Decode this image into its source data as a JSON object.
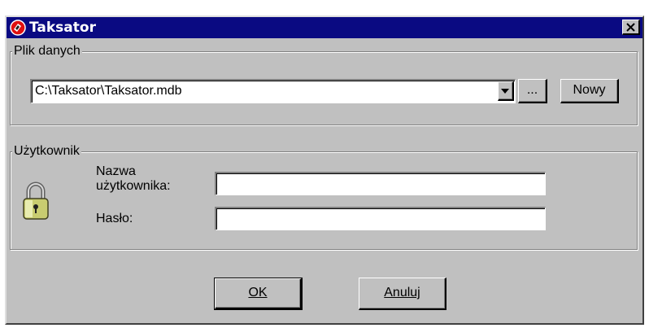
{
  "window": {
    "title": "Taksator",
    "title_bar_color": "#0a0a82",
    "icon": "app-logo-icon",
    "close_icon": "close-icon"
  },
  "data_file_group": {
    "label": "Plik danych",
    "path_value": "C:\\Taksator\\Taksator.mdb",
    "dropdown_icon": "chevron-down-icon",
    "browse_label": "...",
    "new_label": "Nowy"
  },
  "user_group": {
    "label": "Użytkownik",
    "icon": "padlock-icon",
    "username_label": "Nazwa użytkownika:",
    "username_value": "",
    "password_label": "Hasło:",
    "password_value": ""
  },
  "buttons": {
    "ok_label": "OK",
    "cancel_label": "Anuluj"
  }
}
